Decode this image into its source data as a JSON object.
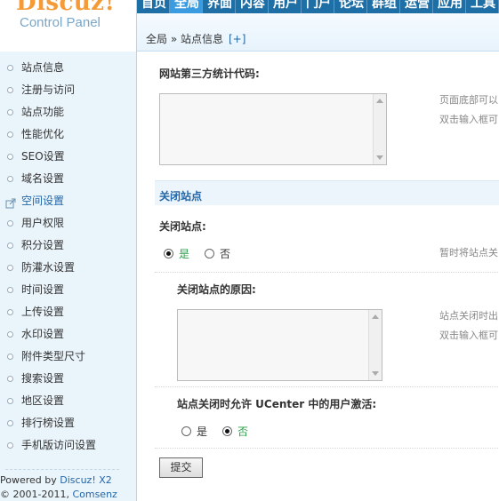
{
  "logo": {
    "brand": "Discuz!",
    "subtitle": "Control Panel"
  },
  "topnav": {
    "items": [
      "首页",
      "全局",
      "界面",
      "内容",
      "用户",
      "门户",
      "论坛",
      "群组",
      "运营",
      "应用",
      "工具"
    ],
    "active_index": 1
  },
  "breadcrumb": {
    "path": "全局 » 站点信息",
    "plus": "[+]"
  },
  "sidebar": {
    "items": [
      "站点信息",
      "注册与访问",
      "站点功能",
      "性能优化",
      "SEO设置",
      "域名设置",
      "空间设置",
      "用户权限",
      "积分设置",
      "防灌水设置",
      "时间设置",
      "上传设置",
      "水印设置",
      "附件类型尺寸",
      "搜索设置",
      "地区设置",
      "排行榜设置",
      "手机版访问设置"
    ],
    "active_index": 6,
    "footer_powered": "Powered by",
    "footer_product": "Discuz! X2",
    "footer_copyright": "© 2001-2011,",
    "footer_company": "Comsenz Inc."
  },
  "main": {
    "stat_code_label": "网站第三方统计代码:",
    "stat_code_hint1": "页面底部可以",
    "stat_code_hint2": "双击输入框可",
    "stat_code_value": "",
    "close_section_title": "关闭站点",
    "close_site_label": "关闭站点:",
    "close_site_options": [
      "是",
      "否"
    ],
    "close_site_selected": "是",
    "close_site_hint": "暂时将站点关",
    "close_reason_label": "关闭站点的原因:",
    "close_reason_hint1": "站点关闭时出",
    "close_reason_hint2": "双击输入框可",
    "close_reason_value": "",
    "ucenter_label": "站点关闭时允许 UCenter 中的用户激活:",
    "ucenter_options": [
      "是",
      "否"
    ],
    "ucenter_selected": "否",
    "submit_label": "提交"
  },
  "colors": {
    "nav_bg": "#1f6fa7",
    "nav_active": "#3b9be0",
    "accent_link": "#2366a8",
    "selected_green": "#2aa04a",
    "logo_orange": "#f49a36"
  }
}
